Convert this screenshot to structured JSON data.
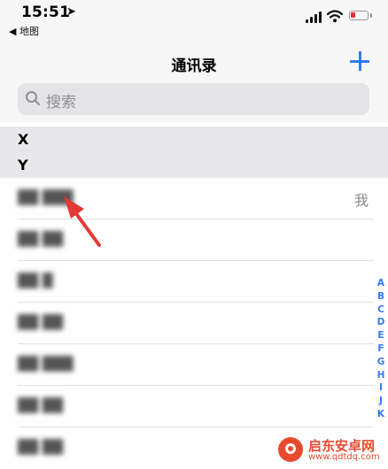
{
  "status_bar": {
    "time": "15:51",
    "back_app": "◀ 地图",
    "battery_color": "#e4333b"
  },
  "nav": {
    "title": "通讯录",
    "add_icon": "plus-icon"
  },
  "search": {
    "placeholder": "搜索",
    "icon": "search-icon"
  },
  "sections": [
    {
      "letter": "X"
    },
    {
      "letter": "Y"
    }
  ],
  "contacts": [
    {
      "name": "██ ███",
      "me_label": "我"
    },
    {
      "name": "██ ██"
    },
    {
      "name": "██ █"
    },
    {
      "name": "██ ██"
    },
    {
      "name": "██ ███"
    },
    {
      "name": "██ ██"
    },
    {
      "name": "██ ██"
    }
  ],
  "index_letters": [
    "A",
    "B",
    "C",
    "D",
    "E",
    "F",
    "G",
    "H",
    "I",
    "J",
    "K"
  ],
  "watermark": {
    "title": "启东安卓网",
    "url": "www.qdtdq.com"
  },
  "accent_color": "#2f7bf6"
}
